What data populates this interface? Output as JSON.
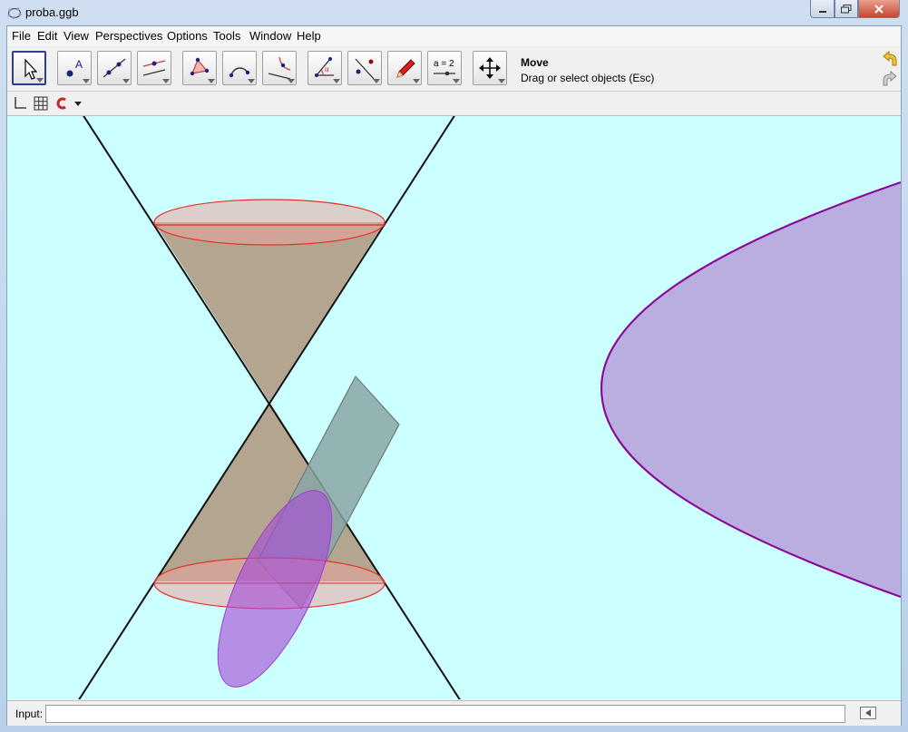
{
  "window": {
    "title": "proba.ggb"
  },
  "menu": [
    "File",
    "Edit",
    "View",
    "Perspectives",
    "Options",
    "Tools",
    "Window",
    "Help"
  ],
  "toolbar": {
    "tools": [
      {
        "name": "move-tool",
        "icon": "arrow-cursor-icon"
      },
      {
        "name": "point-tool",
        "icon": "point-icon"
      },
      {
        "name": "line-tool",
        "icon": "line-through-points-icon"
      },
      {
        "name": "parallel-tool",
        "icon": "perpendicular-line-icon"
      },
      {
        "name": "polygon-tool",
        "icon": "polygon-icon"
      },
      {
        "name": "circle-tool",
        "icon": "circle-arc-icon"
      },
      {
        "name": "conic-tool",
        "icon": "conic-icon"
      },
      {
        "name": "angle-tool",
        "icon": "angle-icon"
      },
      {
        "name": "reflect-tool",
        "icon": "reflect-icon"
      },
      {
        "name": "pen-tool",
        "icon": "pencil-icon"
      },
      {
        "name": "slider-tool",
        "icon": "slider-icon",
        "label": "a = 2"
      },
      {
        "name": "move-graphics-tool",
        "icon": "move-view-icon"
      }
    ],
    "active_tool_title": "Move",
    "active_tool_help": "Drag or select objects (Esc)"
  },
  "stylebar": {
    "icons": [
      "axes-icon",
      "grid-icon",
      "point-capturing-icon",
      "dropdown-arrow-icon"
    ]
  },
  "input": {
    "label": "Input:",
    "value": "",
    "placeholder": ""
  },
  "colors": {
    "graphics_bg": "#ccffff",
    "cone_fill": "#b3a58f",
    "cone_edge": "#000000",
    "ellipse_red": "#e8302a",
    "plane_fill": "#8aa6a6",
    "section_purple": "#a64ad6",
    "parabola_stroke": "#8b0a9a",
    "parabola_fill": "#b9aedf"
  }
}
